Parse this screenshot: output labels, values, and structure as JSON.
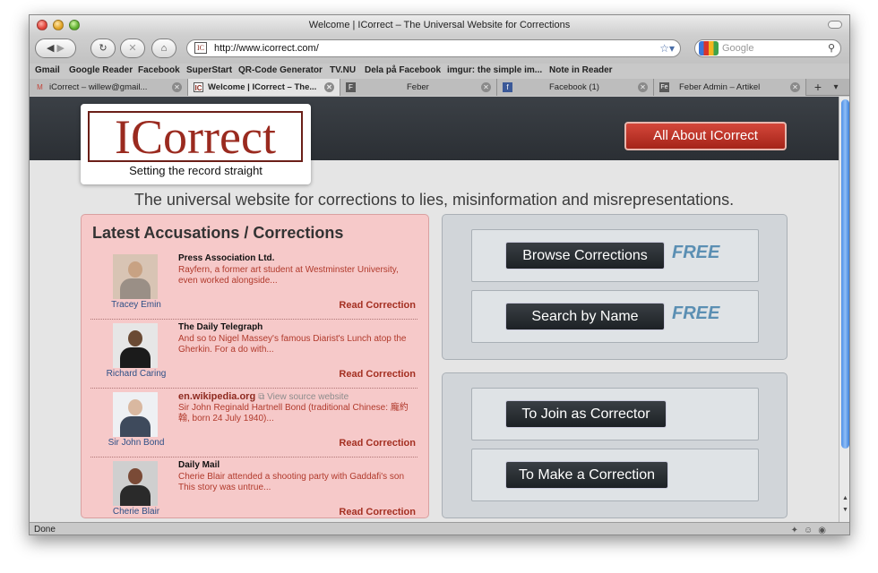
{
  "window": {
    "title": "Welcome | ICorrect – The Universal Website for Corrections"
  },
  "toolbar": {
    "url": "http://www.icorrect.com/",
    "url_favicon": "IC",
    "search_placeholder": "Google",
    "back_icon": "◀",
    "forward_icon": "▶",
    "reload_icon": "↻",
    "stop_icon": "✕",
    "home_icon": "⌂",
    "star_icon": "☆▾",
    "magnifier_icon": "⚲"
  },
  "bookmarks": [
    "Gmail",
    "Google Reader",
    "Facebook",
    "SuperStart",
    "QR-Code Generator",
    "TV.NU",
    "Dela på Facebook",
    "imgur: the simple im...",
    "Note in Reader"
  ],
  "tabs": [
    {
      "label": "iCorrect – willew@gmail...",
      "icon": "M",
      "icon_color": "#c4443a",
      "active": false
    },
    {
      "label": "Welcome | ICorrect – The...",
      "icon": "IC",
      "icon_color": "#8a2b20",
      "active": true
    },
    {
      "label": "Feber",
      "icon": "F",
      "icon_color": "#5a5a5a",
      "active": false
    },
    {
      "label": "Facebook (1)",
      "icon": "f",
      "icon_color": "#3b5998",
      "active": false
    },
    {
      "label": "Feber Admin – Artikel",
      "icon": "Fe",
      "icon_color": "#5a5a5a",
      "active": false
    }
  ],
  "tab_close_icon": "✕",
  "tab_new_icon": "+",
  "tab_menu_icon": "▾",
  "header": {
    "logo_text": "ICorrect",
    "logo_tagline": "Setting the record straight",
    "about_button": "All About ICorrect"
  },
  "tagline": "The universal website for corrections to lies, misinformation and misrepresentations.",
  "accusations": {
    "title": "Latest Accusations / Corrections",
    "items": [
      {
        "name": "Tracey Emin",
        "source": "Press Association Ltd.",
        "source_extra": "",
        "snippet": "Rayfern, a former art student at Westminster University, even worked alongside...",
        "link": "Read Correction"
      },
      {
        "name": "Richard Caring",
        "source": "The Daily Telegraph",
        "source_extra": "",
        "snippet": "And so to Nigel Massey's famous Diarist's Lunch atop the Gherkin. For a do with...",
        "link": "Read Correction"
      },
      {
        "name": "Sir John Bond",
        "source": "en.wikipedia.org",
        "source_extra": "View source website",
        "snippet": "Sir John Reginald Hartnell Bond (traditional Chinese: 龐約翰, born 24 July 1940)...",
        "link": "Read Correction"
      },
      {
        "name": "Cherie Blair",
        "source": "Daily Mail",
        "source_extra": "",
        "snippet": "Cherie Blair attended a shooting party with Gaddafi's son This story was untrue...",
        "link": "Read Correction"
      }
    ]
  },
  "panel_top": {
    "browse_button": "Browse Corrections",
    "search_button": "Search by Name",
    "free_label": "FREE"
  },
  "panel_bottom": {
    "join_button": "To Join as Corrector",
    "make_button": "To Make a Correction"
  },
  "statusbar": {
    "text": "Done"
  },
  "colors": {
    "accent_red": "#a52419",
    "free_blue": "#5b8fb3",
    "panel_pink": "#f6c9c9"
  }
}
